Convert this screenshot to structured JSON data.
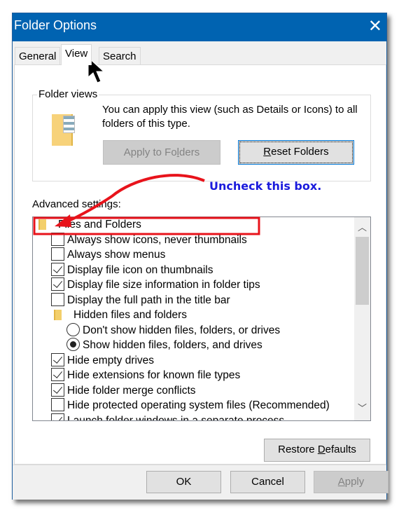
{
  "window": {
    "title": "Folder Options",
    "close_icon": "close-icon"
  },
  "tabs": [
    {
      "label": "General"
    },
    {
      "label": "View",
      "active": true
    },
    {
      "label": "Search"
    }
  ],
  "folder_views": {
    "legend": "Folder views",
    "text": "You can apply this view (such as Details or Icons) to all folders of this type.",
    "apply_pre": "Apply to Fo",
    "apply_ul": "l",
    "apply_post": "ders",
    "reset_ul": "R",
    "reset_post": "eset Folders"
  },
  "advanced": {
    "label": "Advanced settings:",
    "items": [
      {
        "type": "folder",
        "label": "Files and Folders"
      },
      {
        "type": "checkbox",
        "label": "Always show icons, never thumbnails",
        "checked": false
      },
      {
        "type": "checkbox",
        "label": "Always show menus",
        "checked": false
      },
      {
        "type": "checkbox",
        "label": "Display file icon on thumbnails",
        "checked": true
      },
      {
        "type": "checkbox",
        "label": "Display file size information in folder tips",
        "checked": true
      },
      {
        "type": "checkbox",
        "label": "Display the full path in the title bar",
        "checked": false
      },
      {
        "type": "folder",
        "label": "Hidden files and folders"
      },
      {
        "type": "radio",
        "label": "Don't show hidden files, folders, or drives",
        "checked": false
      },
      {
        "type": "radio",
        "label": "Show hidden files, folders, and drives",
        "checked": true
      },
      {
        "type": "checkbox",
        "label": "Hide empty drives",
        "checked": true
      },
      {
        "type": "checkbox",
        "label": "Hide extensions for known file types",
        "checked": true
      },
      {
        "type": "checkbox",
        "label": "Hide folder merge conflicts",
        "checked": true
      },
      {
        "type": "checkbox",
        "label": "Hide protected operating system files (Recommended)",
        "checked": false
      },
      {
        "type": "checkbox",
        "label": "Launch folder windows in a separate process",
        "checked": true
      }
    ]
  },
  "restore": {
    "pre": "Restore ",
    "ul": "D",
    "post": "efaults"
  },
  "footer": {
    "ok": "OK",
    "cancel": "Cancel",
    "apply_ul": "A",
    "apply_post": "pply"
  },
  "annotation": {
    "text": "Uncheck this box.",
    "text_color": "#1a1adc",
    "highlight_color": "#e8131b"
  },
  "colors": {
    "titlebar": "#0063b1"
  }
}
